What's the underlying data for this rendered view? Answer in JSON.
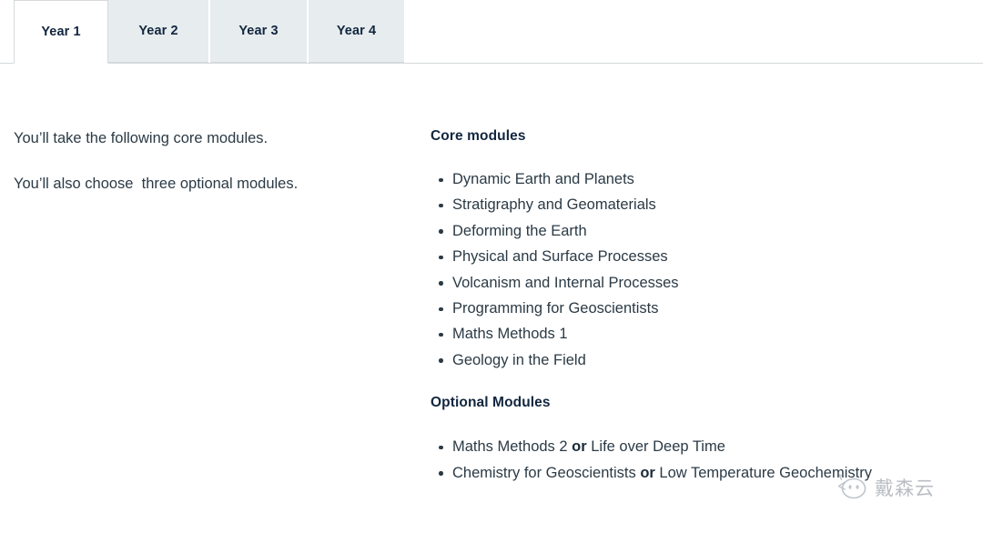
{
  "tabs": [
    {
      "label": "Year 1",
      "active": true
    },
    {
      "label": "Year 2",
      "active": false
    },
    {
      "label": "Year 3",
      "active": false
    },
    {
      "label": "Year 4",
      "active": false
    }
  ],
  "left_column": {
    "paragraph_1": "You’ll take the following core modules.",
    "paragraph_2": "You’ll also choose  three optional modules."
  },
  "right_column": {
    "core_heading": "Core modules",
    "core_modules": [
      "Dynamic Earth and Planets",
      "Stratigraphy and Geomaterials",
      "Deforming the Earth",
      "Physical and Surface Processes",
      "Volcanism and Internal Processes",
      "Programming for Geoscientists",
      "Maths Methods 1",
      "Geology in the Field"
    ],
    "optional_heading": "Optional Modules",
    "optional_modules": [
      {
        "first": "Maths Methods 2 ",
        "conjunction": "or",
        "second": " Life over Deep Time"
      },
      {
        "first": "Chemistry for Geoscientists ",
        "conjunction": "or",
        "second": " Low Temperature Geochemistry"
      }
    ]
  },
  "watermark": {
    "icon": "chat-bubble-face-icon",
    "text": "戴森云"
  },
  "colors": {
    "tab_active_background": "#ffffff",
    "tab_inactive_background": "#e7ecee",
    "tab_text": "#12263f",
    "heading_text": "#12263f",
    "body_text": "#2b3a45",
    "border": "#d5d9dc",
    "page_background": "#ffffff"
  }
}
